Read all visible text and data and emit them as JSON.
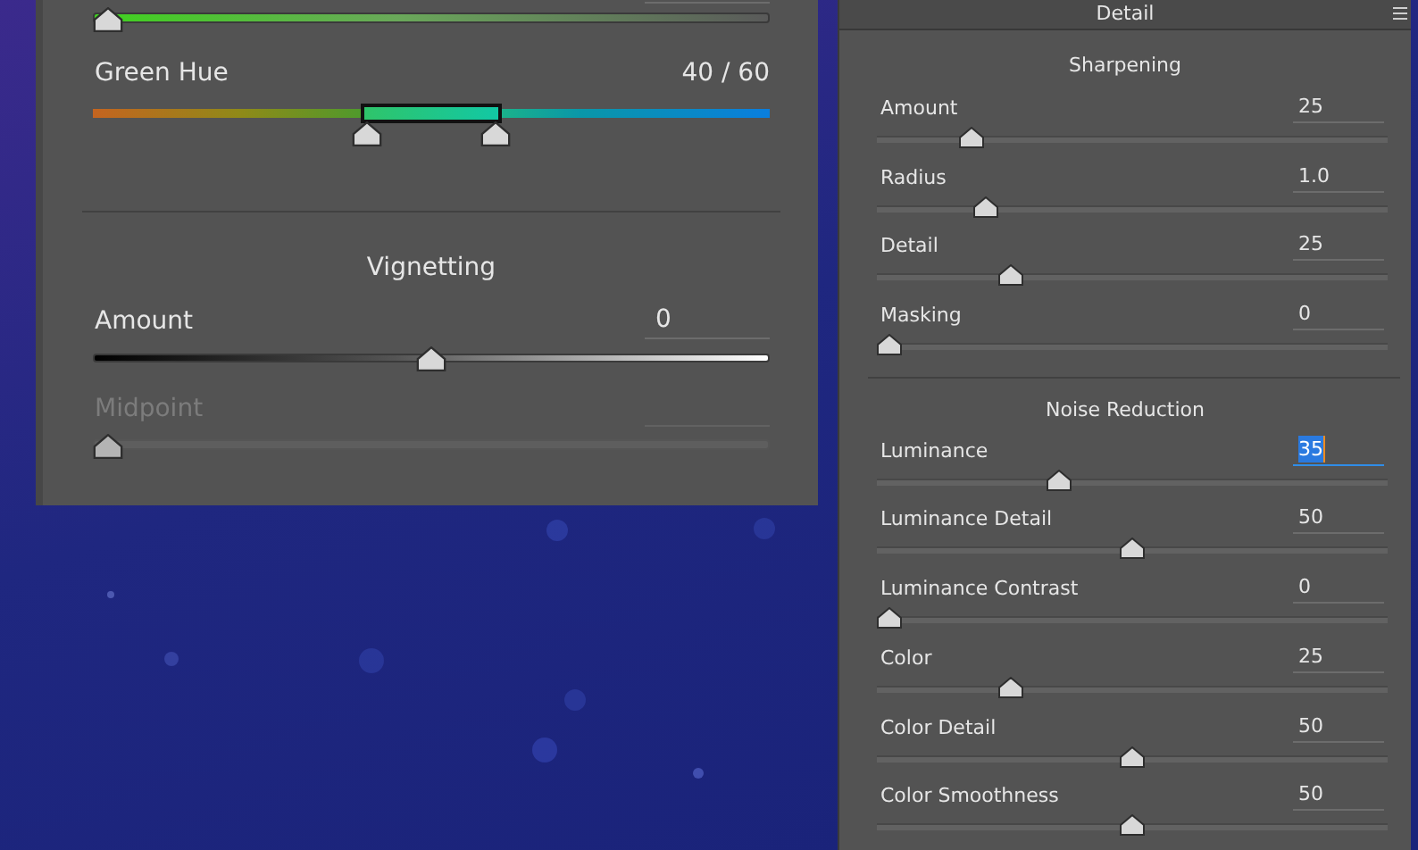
{
  "left_panel": {
    "items": [
      {
        "kind": "saturation",
        "level": 0,
        "disabled": false
      },
      {
        "kind": "range",
        "label": "Green Hue",
        "value": "40 / 60",
        "thumbs": [
          {
            "level": 0.4
          },
          {
            "level": 0.6
          }
        ]
      },
      {
        "kind": "divider"
      },
      {
        "kind": "heading",
        "label": "Vignetting"
      },
      {
        "kind": "vignette",
        "label": "Amount",
        "value": "0",
        "level": 0.5,
        "disabled": false
      },
      {
        "kind": "slider",
        "label": "Midpoint",
        "level": 0,
        "disabled": true
      }
    ]
  },
  "detail_panel": {
    "title": "Detail",
    "sections": [
      {
        "title": "Sharpening",
        "sliders": [
          {
            "label": "Amount",
            "value": "25",
            "level": 0.17,
            "focused": false
          },
          {
            "label": "Radius",
            "value": "1.0",
            "level": 0.2,
            "focused": false
          },
          {
            "label": "Detail",
            "value": "25",
            "level": 0.25,
            "focused": false
          },
          {
            "label": "Masking",
            "value": "0",
            "level": 0,
            "focused": false
          }
        ]
      },
      {
        "title": "Noise Reduction",
        "sliders": [
          {
            "label": "Luminance",
            "value": "35",
            "level": 0.35,
            "focused": true
          },
          {
            "label": "Luminance Detail",
            "value": "50",
            "level": 0.5,
            "focused": false
          },
          {
            "label": "Luminance Contrast",
            "value": "0",
            "level": 0,
            "focused": false
          },
          {
            "label": "Color",
            "value": "25",
            "level": 0.25,
            "focused": false
          },
          {
            "label": "Color Detail",
            "value": "50",
            "level": 0.5,
            "focused": false
          },
          {
            "label": "Color Smoothness",
            "value": "50",
            "level": 0.5,
            "focused": false
          }
        ]
      }
    ]
  }
}
